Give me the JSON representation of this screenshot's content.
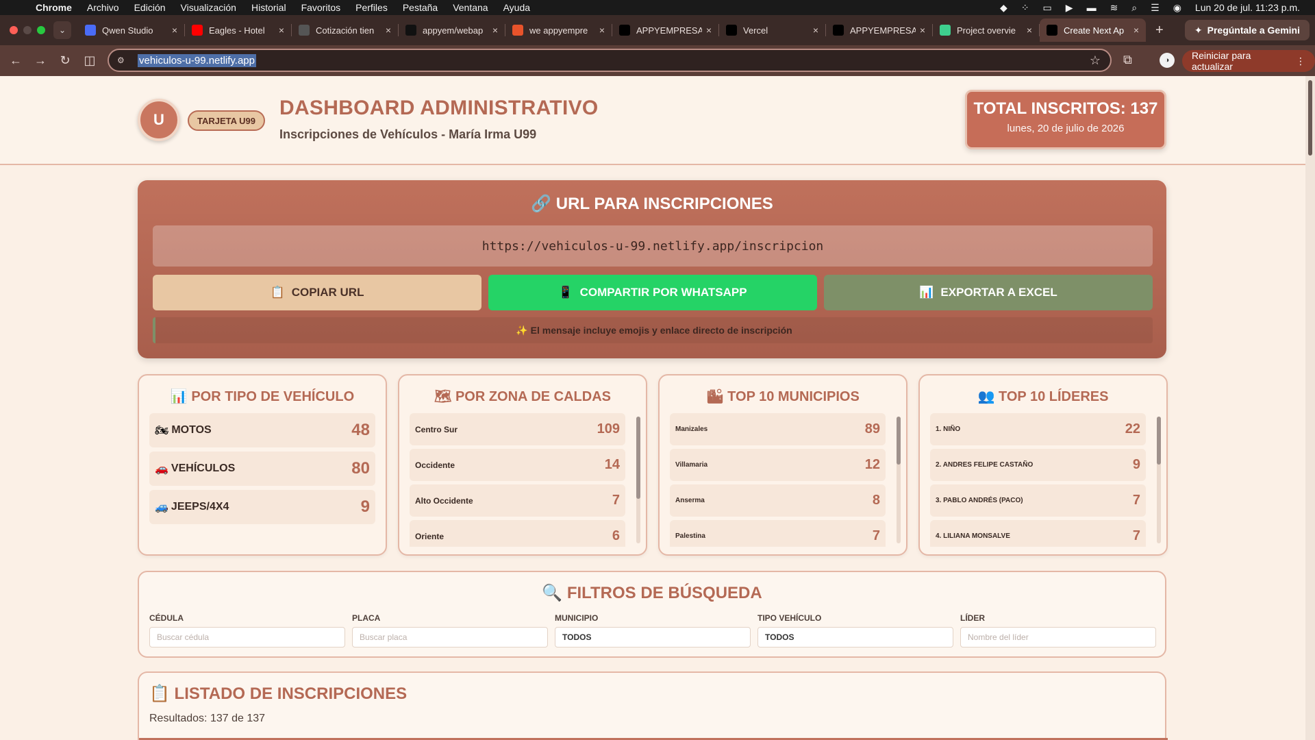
{
  "menubar": {
    "app": "Chrome",
    "items": [
      "Archivo",
      "Edición",
      "Visualización",
      "Historial",
      "Favoritos",
      "Perfiles",
      "Pestaña",
      "Ventana",
      "Ayuda"
    ],
    "datetime": "Lun 20 de jul.  11:23 p.m."
  },
  "tabs": [
    {
      "title": "Qwen Studio",
      "favicon": "qwen-icon",
      "color": "#4a6cf7"
    },
    {
      "title": "Eagles - Hotel",
      "favicon": "youtube-icon",
      "color": "#ff0000"
    },
    {
      "title": "Cotización tien",
      "favicon": "chatgpt-icon",
      "color": "#555555"
    },
    {
      "title": "appyem/webap",
      "favicon": "github-icon",
      "color": "#111111"
    },
    {
      "title": "we appyempre",
      "favicon": "flame-icon",
      "color": "#e8532b"
    },
    {
      "title": "APPYEMPRESA",
      "favicon": "vercel-icon",
      "color": "#000000"
    },
    {
      "title": "Vercel",
      "favicon": "vercel-icon",
      "color": "#000000"
    },
    {
      "title": "APPYEMPRESA",
      "favicon": "vercel-icon",
      "color": "#000000"
    },
    {
      "title": "Project overvie",
      "favicon": "supabase-icon",
      "color": "#3ecf8e"
    },
    {
      "title": "Create Next Ap",
      "favicon": "vercel-icon",
      "color": "#000000",
      "active": true
    }
  ],
  "gemini": "Pregúntale a Gemini",
  "address": "vehiculos-u-99.netlify.app",
  "update_label": "Reiniciar para actualizar",
  "header": {
    "logo_letter": "U",
    "badge": "TARJETA U99",
    "title": "DASHBOARD ADMINISTRATIVO",
    "subtitle": "Inscripciones de Vehículos - María Irma U99",
    "total_label": "TOTAL INSCRITOS: 137",
    "date": "lunes, 20 de julio de 2026"
  },
  "url_panel": {
    "title": "🔗 URL PARA INSCRIPCIONES",
    "url": "https://vehiculos-u-99.netlify.app/inscripcion",
    "copy_label": "COPIAR URL",
    "whatsapp_label": "COMPARTIR POR WHATSAPP",
    "excel_label": "EXPORTAR A EXCEL",
    "hint": "✨ El mensaje incluye emojis y enlace directo de inscripción"
  },
  "vehicle_types": {
    "title": "📊 POR TIPO DE VEHÍCULO",
    "items": [
      {
        "icon": "🏍",
        "label": "MOTOS",
        "value": "48"
      },
      {
        "icon": "🚗",
        "label": "VEHÍCULOS",
        "value": "80"
      },
      {
        "icon": "🚙",
        "label": "JEEPS/4X4",
        "value": "9"
      }
    ]
  },
  "zones": {
    "title": "🗺 POR ZONA DE CALDAS",
    "items": [
      {
        "label": "Centro Sur",
        "value": "109"
      },
      {
        "label": "Occidente",
        "value": "14"
      },
      {
        "label": "Alto Occidente",
        "value": "7"
      },
      {
        "label": "Oriente",
        "value": "6"
      }
    ]
  },
  "municipalities": {
    "title": "🏙 TOP 10 MUNICIPIOS",
    "items": [
      {
        "label": "Manizales",
        "value": "89"
      },
      {
        "label": "Villamaria",
        "value": "12"
      },
      {
        "label": "Anserma",
        "value": "8"
      },
      {
        "label": "Palestina",
        "value": "7"
      }
    ]
  },
  "leaders": {
    "title": "👥 TOP 10 LÍDERES",
    "items": [
      {
        "label": "1. NIÑO",
        "value": "22"
      },
      {
        "label": "2. ANDRES FELIPE CASTAÑO",
        "value": "9"
      },
      {
        "label": "3. PABLO ANDRÉS (PACO)",
        "value": "7"
      },
      {
        "label": "4. LILIANA MONSALVE",
        "value": "7"
      }
    ]
  },
  "filters": {
    "title": "🔍 FILTROS DE BÚSQUEDA",
    "cedula_label": "CÉDULA",
    "cedula_placeholder": "Buscar cédula",
    "placa_label": "PLACA",
    "placa_placeholder": "Buscar placa",
    "municipio_label": "MUNICIPIO",
    "municipio_value": "TODOS",
    "tipo_label": "TIPO VEHÍCULO",
    "tipo_value": "TODOS",
    "lider_label": "LÍDER",
    "lider_placeholder": "Nombre del líder"
  },
  "listing": {
    "title": "📋 LISTADO DE INSCRIPCIONES",
    "results": "Resultados: 137 de 137"
  }
}
